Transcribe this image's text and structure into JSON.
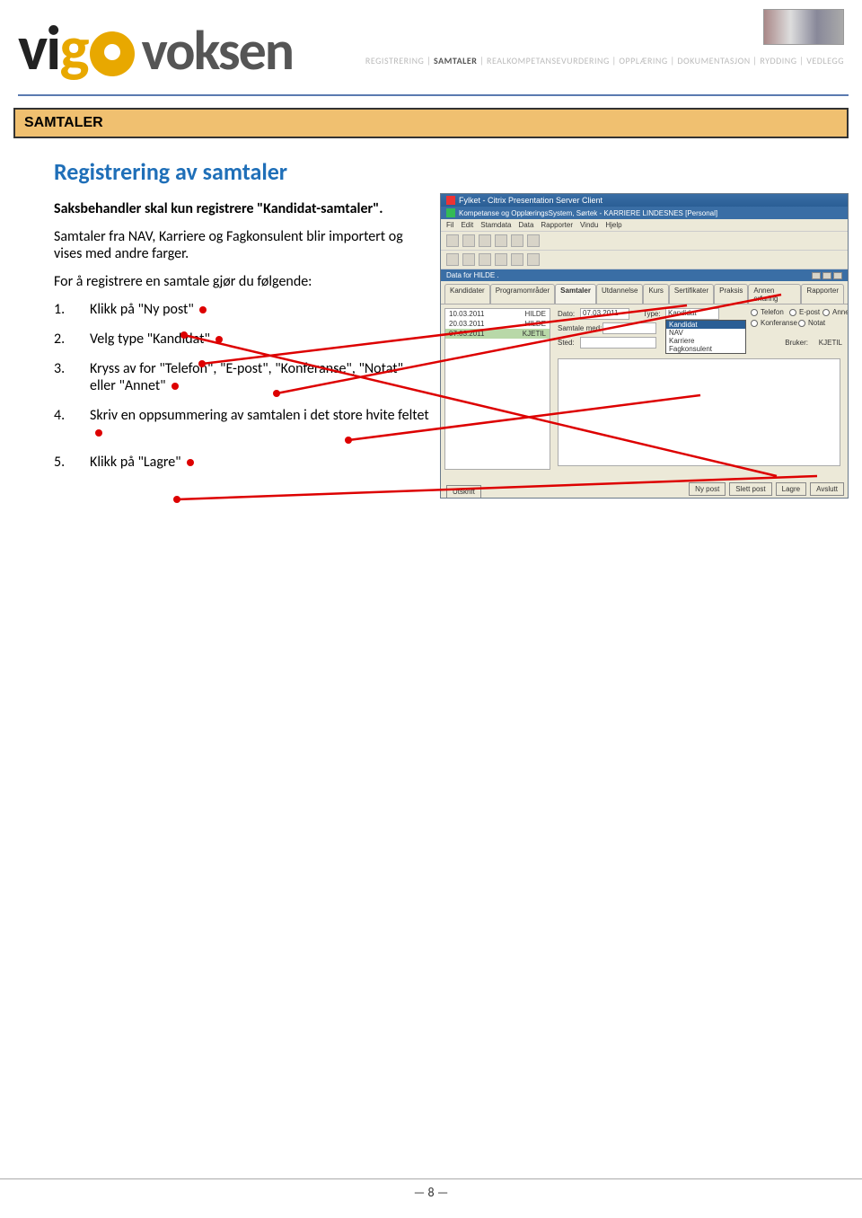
{
  "header": {
    "logo_prefix": "vi",
    "logo_g": "g",
    "logo_suffix": "voksen",
    "breadcrumb": [
      "REGISTRERING",
      "SAMTALER",
      "REALKOMPETANSEVURDERING",
      "OPPLÆRING",
      "DOKUMENTASJON",
      "RYDDING",
      "VEDLEGG"
    ],
    "breadcrumb_active_index": 1
  },
  "section_bar": "SAMTALER",
  "content": {
    "title": "Registrering av samtaler",
    "intro_bold": "Saksbehandler skal kun registrere \"Kandidat-samtaler\".",
    "intro2": "Samtaler fra NAV, Karriere og Fagkonsulent blir importert og vises med andre farger.",
    "intro3": "For å registrere en samtale gjør du følgende:",
    "steps": [
      "Klikk på \"Ny post\"",
      "Velg type \"Kandidat\"",
      "Kryss av for \"Telefon\", \"E-post\", \"Konferanse\", \"Notat\" eller \"Annet\"",
      "Skriv en oppsummering av samtalen i det store hvite feltet",
      "Klikk på \"Lagre\""
    ]
  },
  "screenshot": {
    "window_title": "Fylket - Citrix Presentation Server Client",
    "subtitle": "Kompetanse og OpplæringsSystem, Sørtek - KARRIERE LINDESNES [Personal]",
    "menus": [
      "Fil",
      "Edit",
      "Stamdata",
      "Data",
      "Rapporter",
      "Vindu",
      "Hjelp"
    ],
    "data_header": "Data for HILDE .",
    "tabs": [
      "Kandidater",
      "Programområder",
      "Samtaler",
      "Utdannelse",
      "Kurs",
      "Sertifikater",
      "Praksis",
      "Annen erfaring",
      "Rapporter"
    ],
    "active_tab_index": 2,
    "left_rows": [
      {
        "date": "10.03.2011",
        "name": "HILDE"
      },
      {
        "date": "20.03.2011",
        "name": "HILDE"
      },
      {
        "date": "07.03.2011",
        "name": "KJETIL"
      }
    ],
    "dato_label": "Dato:",
    "dato_value": "07.03.2011",
    "type_label": "Type:",
    "type_selected": "Kandidat",
    "type_options": [
      "Kandidat",
      "NAV",
      "Karriere",
      "Fagkonsulent"
    ],
    "samtale_med_label": "Samtale med:",
    "sted_label": "Sted:",
    "checks": [
      "Telefon",
      "E-post",
      "Annet",
      "Konferanse",
      "Notat"
    ],
    "bruker_label": "Bruker:",
    "bruker_value": "KJETIL",
    "left_button": "Utskrift",
    "buttons": [
      "Ny post",
      "Slett post",
      "Lagre",
      "Avslutt"
    ]
  },
  "page_number": "— 8 —"
}
